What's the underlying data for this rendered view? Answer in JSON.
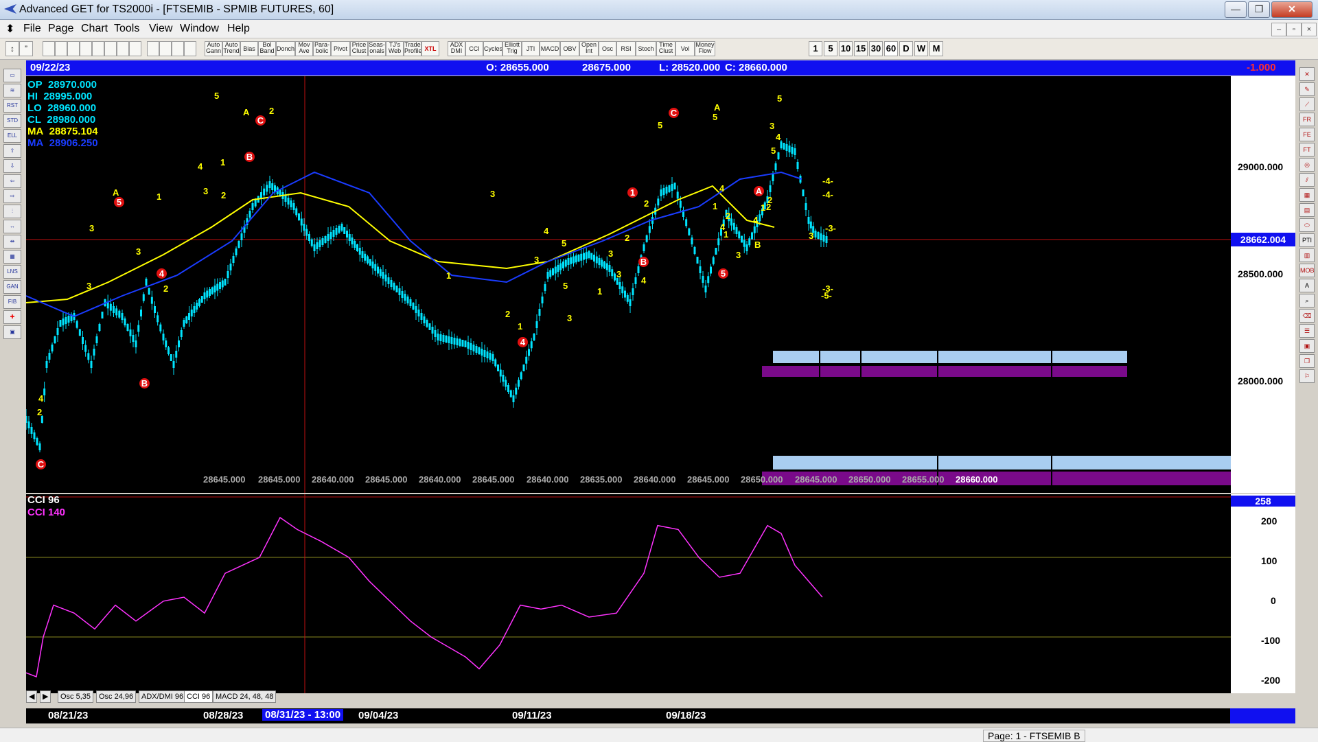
{
  "window": {
    "title": "Advanced GET for TS2000i - [FTSEMIB - SPMIB FUTURES, 60]",
    "buttons": {
      "minimize": "—",
      "maximize": "❐",
      "close": "✕"
    }
  },
  "menu": [
    "File",
    "Page",
    "Chart",
    "Tools",
    "View",
    "Window",
    "Help"
  ],
  "toolbar": {
    "study_buttons": [
      "Auto Gann",
      "Auto Trend",
      "Bias",
      "Bol Band",
      "Donch",
      "Mov Ave",
      "Para-bolic",
      "Pivot",
      "Price Clust",
      "Seas-onals",
      "TJ's Web",
      "Trade Profile",
      "XTL",
      "ADX DMI",
      "CCI",
      "Cycles",
      "Elliott Trig",
      "JTI",
      "MACD",
      "OBV",
      "Open Int",
      "Osc",
      "RSI",
      "Stoch",
      "Time Clust",
      "Vol",
      "Money Flow"
    ],
    "intervals": [
      "1",
      "5",
      "10",
      "15",
      "30",
      "60",
      "D",
      "W",
      "M"
    ]
  },
  "info_bar": {
    "date": "09/22/23",
    "open": "O: 28655.000",
    "high": "28675.000",
    "low": "L: 28520.000",
    "close": "C: 28660.000",
    "change": "-1.000"
  },
  "price_legend": [
    {
      "label": "OP",
      "value": "28970.000",
      "color": "#00e5ff"
    },
    {
      "label": "HI",
      "value": "28995.000",
      "color": "#00e5ff"
    },
    {
      "label": "LO",
      "value": "28960.000",
      "color": "#00e5ff"
    },
    {
      "label": "CL",
      "value": "28980.000",
      "color": "#00e5ff"
    },
    {
      "label": "MA",
      "value": "28875.104",
      "color": "#ffff00"
    },
    {
      "label": "MA",
      "value": "28906.250",
      "color": "#1a3cff"
    }
  ],
  "price_axis": {
    "ticks": [
      "29000.000",
      "28500.000",
      "28000.000"
    ],
    "current": "28662.004"
  },
  "bottom_values": [
    "28645.000",
    "28645.000",
    "28640.000",
    "28645.000",
    "28640.000",
    "28645.000",
    "28640.000",
    "28635.000",
    "28640.000",
    "28645.000",
    "28650.000",
    "28645.000",
    "28650.000",
    "28655.000",
    "28660.000"
  ],
  "elliott_labels": [
    "C",
    "5",
    "A",
    "2",
    "C",
    "B",
    "1",
    "4",
    "3",
    "2",
    "1",
    "3",
    "2",
    "4",
    "3",
    "3",
    "4",
    "A",
    "5",
    "B",
    "2",
    "1",
    "2",
    "1",
    "3",
    "4",
    "5",
    "5",
    "3",
    "3",
    "4",
    "A",
    "5",
    "C",
    "5",
    "1",
    "2",
    "B",
    "3",
    "2",
    "1",
    "4",
    "3",
    "4",
    "1",
    "4",
    "2",
    "1",
    "3",
    "5",
    "A",
    "B",
    "2",
    "5",
    "4",
    "3",
    "5",
    "2",
    "1",
    "4",
    "-4-",
    "-4-",
    "-3-",
    "3",
    "-3-",
    "-5-"
  ],
  "cci": {
    "legend": [
      {
        "label": "CCI 96",
        "color": "#ffffff"
      },
      {
        "label": "CCI  140",
        "color": "#ff33ff"
      }
    ],
    "current": "258",
    "ticks": [
      "200",
      "100",
      "0",
      "-100",
      "-200"
    ]
  },
  "tabs": [
    "Osc 5,35",
    "Osc 24,96",
    "ADX/DMI 96",
    "CCI 96",
    "MACD 24, 48, 48"
  ],
  "date_axis": [
    "08/21/23",
    "08/28/23",
    "08/31/23 - 13:00",
    "09/04/23",
    "09/11/23",
    "09/18/23"
  ],
  "status": "Page: 1 - FTSEMIB B",
  "chart_data": {
    "type": "line",
    "series": [
      {
        "name": "MA",
        "value_last": 28875.104
      },
      {
        "name": "MA",
        "value_last": 28906.25
      }
    ],
    "ylim": [
      27600,
      29300
    ],
    "cci_ylim": [
      -200,
      258
    ]
  }
}
